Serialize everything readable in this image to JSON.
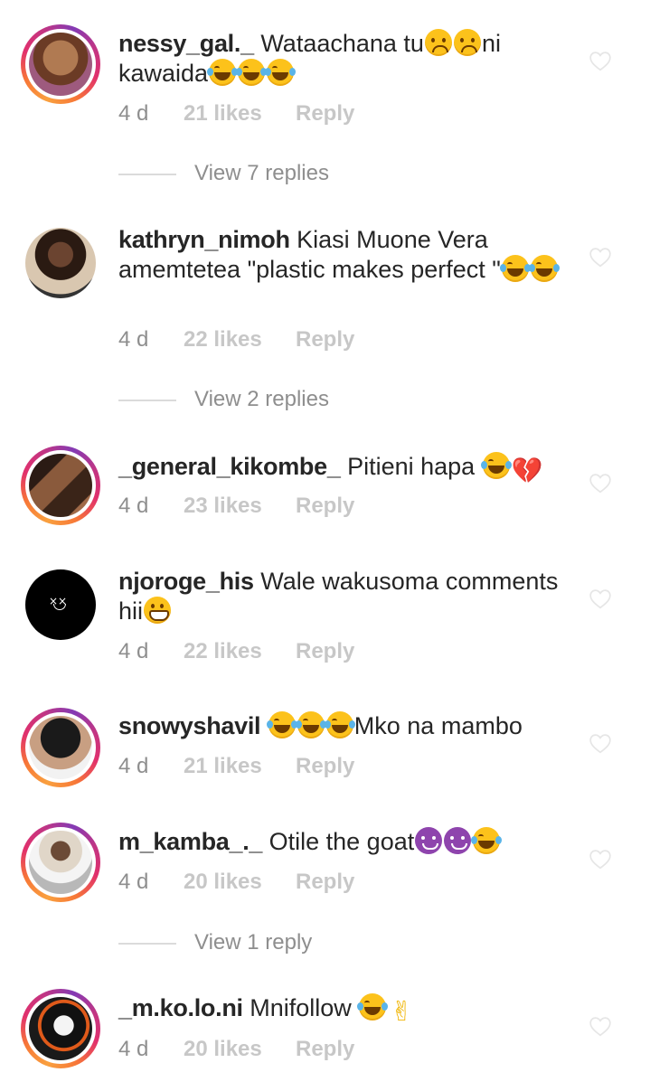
{
  "comments": [
    {
      "username": "nessy_gal._",
      "text_before": "Wataachana tu",
      "text_mid": "ni kawaida",
      "time": "4 d",
      "likes": "21 likes",
      "reply": "Reply",
      "view_replies": "View 7 replies"
    },
    {
      "username": "kathryn_nimoh",
      "text_before": "Kiasi Muone Vera amemtetea \"plastic makes perfect \"",
      "time": "4 d",
      "likes": "22 likes",
      "reply": "Reply",
      "view_replies": "View 2 replies"
    },
    {
      "username": "_general_kikombe_",
      "text_before": "Pitieni hapa ",
      "time": "4 d",
      "likes": "23 likes",
      "reply": "Reply"
    },
    {
      "username": "njoroge_his",
      "text_before": "Wale wakusoma comments hii",
      "time": "4 d",
      "likes": "22 likes",
      "reply": "Reply"
    },
    {
      "username": "snowyshavil",
      "text_after": "Mko na mambo",
      "time": "4 d",
      "likes": "21 likes",
      "reply": "Reply"
    },
    {
      "username": "m_kamba_._",
      "text_before": "Otile the goat",
      "time": "4 d",
      "likes": "20 likes",
      "reply": "Reply",
      "view_replies": "View 1 reply"
    },
    {
      "username": "_m.ko.lo.ni",
      "text_before": "Mnifollow ",
      "time": "4 d",
      "likes": "20 likes",
      "reply": "Reply"
    }
  ],
  "icons": {
    "heart": "heart-outline-icon",
    "emoji_sad": "sad-face-emoji",
    "emoji_laugh": "tears-of-joy-emoji",
    "emoji_grin": "grinning-face-emoji",
    "emoji_devil": "smiling-devil-emoji",
    "emoji_heartbreak": "broken-heart-emoji",
    "emoji_victory": "victory-hand-emoji"
  },
  "colors": {
    "text": "#262626",
    "meta": "#8e8e8e",
    "meta_faint": "#c7c7c7",
    "divider": "#dbdbdb",
    "story_ring_start": "#f9a03f",
    "story_ring_end": "#c13584"
  }
}
